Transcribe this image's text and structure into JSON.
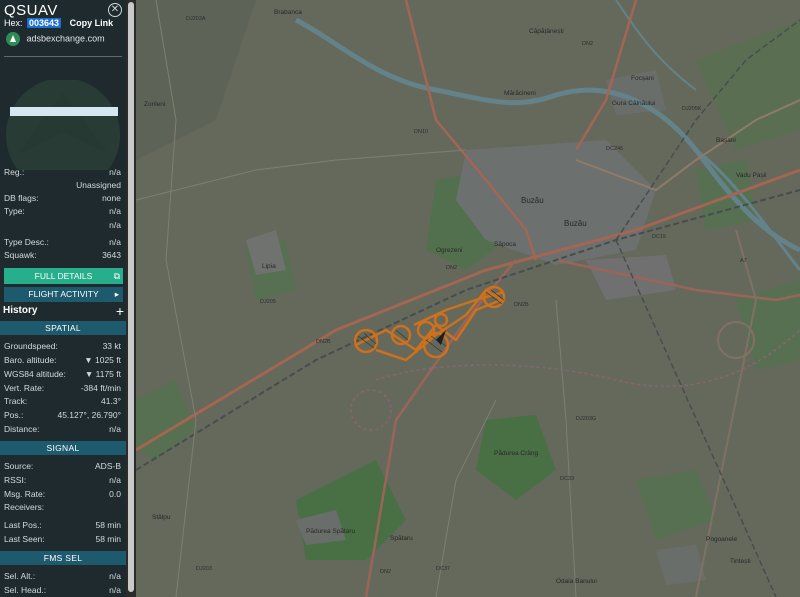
{
  "header": {
    "title": "QSUAV",
    "hex_label": "Hex:",
    "hex_value": "003643",
    "copy_label": "Copy Link",
    "source_site": "adsbexchange.com"
  },
  "aircraft": [
    {
      "k": "Reg.:",
      "v": "n/a"
    },
    {
      "k": "",
      "v": "Unassigned"
    },
    {
      "k": "DB flags:",
      "v": "none"
    },
    {
      "k": "Type:",
      "v": "n/a"
    },
    {
      "k": "",
      "v": "n/a"
    },
    {
      "k": "Type Desc.:",
      "v": "n/a"
    },
    {
      "k": "Squawk:",
      "v": "3643"
    }
  ],
  "buttons": {
    "full_details": "FULL DETAILS",
    "flight_activity": "FLIGHT ACTIVITY",
    "history": "History"
  },
  "sections": {
    "spatial": "SPATIAL",
    "signal": "SIGNAL",
    "fms": "FMS SEL"
  },
  "spatial": [
    {
      "k": "Groundspeed:",
      "v": "33 kt"
    },
    {
      "k": "Baro. altitude:",
      "v": "▼ 1025 ft"
    },
    {
      "k": "WGS84 altitude:",
      "v": "▼ 1175 ft"
    },
    {
      "k": "Vert. Rate:",
      "v": "-384 ft/min"
    },
    {
      "k": "Track:",
      "v": "41.3°"
    },
    {
      "k": "Pos.:",
      "v": "45.127°, 26.790°"
    },
    {
      "k": "Distance:",
      "v": "n/a"
    }
  ],
  "signal": [
    {
      "k": "Source:",
      "v": "ADS-B"
    },
    {
      "k": "RSSI:",
      "v": "n/a"
    },
    {
      "k": "Msg. Rate:",
      "v": "0.0"
    },
    {
      "k": "Receivers:",
      "v": ""
    },
    {
      "k": "Last Pos.:",
      "v": "58 min"
    },
    {
      "k": "Last Seen:",
      "v": "58 min"
    }
  ],
  "fms": [
    {
      "k": "Sel. Alt.:",
      "v": "n/a"
    },
    {
      "k": "Sel. Head.:",
      "v": "n/a"
    }
  ],
  "map_labels": {
    "buzau": "Buzău",
    "buzau2": "Buzău",
    "brabanca": "Brabanca",
    "zorileni": "Zorileni",
    "focsani": "Focșani",
    "gura": "Gura Câlnăului",
    "basani": "Bașani",
    "vadu": "Vadu Pașii",
    "lipia": "Lipia",
    "stalpu": "Stâlpu",
    "spataru": "Spătaru",
    "padurea": "Pădurea Spătaru",
    "pogoanele": "Pogoanele",
    "tintesti": "Tintești",
    "maracineni": "Mărăcineni",
    "capatanesti": "Căpățânești",
    "sapoca": "Săpoca",
    "ogrezeni": "Ogrezeni",
    "odaia": "Odaia Banului",
    "padurea_crang": "Pădurea Crâng",
    "dn2": "DN2",
    "dn2b": "DN2B",
    "dn10": "DN10",
    "dn2e": "DN2",
    "dj203": "DJ203",
    "dj205": "DJ205",
    "dj203a": "DJ203A",
    "dj205k": "DJ205K",
    "dc246": "DC246",
    "dc15": "DC15",
    "dc33": "DC33",
    "dc37": "DC37",
    "dj203g": "DJ203G",
    "a7": "A7",
    "dn2b2": "DN2B",
    "dn2_s": "DN2"
  },
  "colors": {
    "track": "#e07a1f",
    "sidebar_bg": "#1f2a2e",
    "section": "#1e5a6d",
    "full_details": "#27ae8a",
    "hex_bg": "#1b6fd1"
  }
}
